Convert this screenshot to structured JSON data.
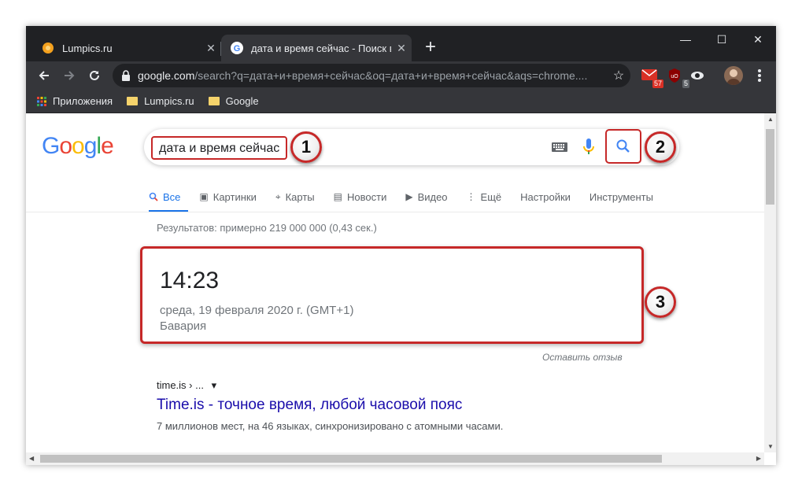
{
  "tabs": [
    {
      "title": "Lumpics.ru",
      "favicon": "orange-circle-icon",
      "close": "✕"
    },
    {
      "title": "дата и время сейчас - Поиск в G",
      "favicon": "google-g-icon",
      "close": "✕"
    }
  ],
  "new_tab_label": "+",
  "window_controls": {
    "minimize": "—",
    "maximize": "☐",
    "close": "✕"
  },
  "toolbar": {
    "url_host": "google.com",
    "url_rest": "/search?q=дата+и+время+сейчас&oq=дата+и+время+сейчас&aqs=chrome....",
    "badges": {
      "mail": "57",
      "ublock": "5"
    }
  },
  "bookmarks": {
    "apps": "Приложения",
    "items": [
      "Lumpics.ru",
      "Google"
    ]
  },
  "search": {
    "query": "дата и время сейчас",
    "tabs": [
      {
        "label": "Все",
        "icon": "search-icon"
      },
      {
        "label": "Картинки",
        "icon": "image-icon"
      },
      {
        "label": "Карты",
        "icon": "pin-icon"
      },
      {
        "label": "Новости",
        "icon": "news-icon"
      },
      {
        "label": "Видео",
        "icon": "play-icon"
      },
      {
        "label": "Ещё",
        "icon": "more-icon"
      },
      {
        "label": "Настройки",
        "icon": ""
      },
      {
        "label": "Инструменты",
        "icon": ""
      }
    ],
    "stats": "Результатов: примерно 219 000 000 (0,43 сек.)"
  },
  "time_card": {
    "time": "14:23",
    "date": "среда, 19 февраля 2020 г. (GMT+1)",
    "place": "Бавария",
    "feedback": "Оставить отзыв"
  },
  "result": {
    "cite": "time.is › ...",
    "cite_arrow": "▾",
    "title": "Time.is - точное время, любой часовой пояс",
    "snippet": "7 миллионов мест, на 46 языках, синхронизировано с атомными часами."
  },
  "markers": [
    "1",
    "2",
    "3"
  ],
  "colors": {
    "annotation_red": "#c62828",
    "link_blue": "#1a0dab",
    "active_tab_blue": "#1a73e8"
  }
}
